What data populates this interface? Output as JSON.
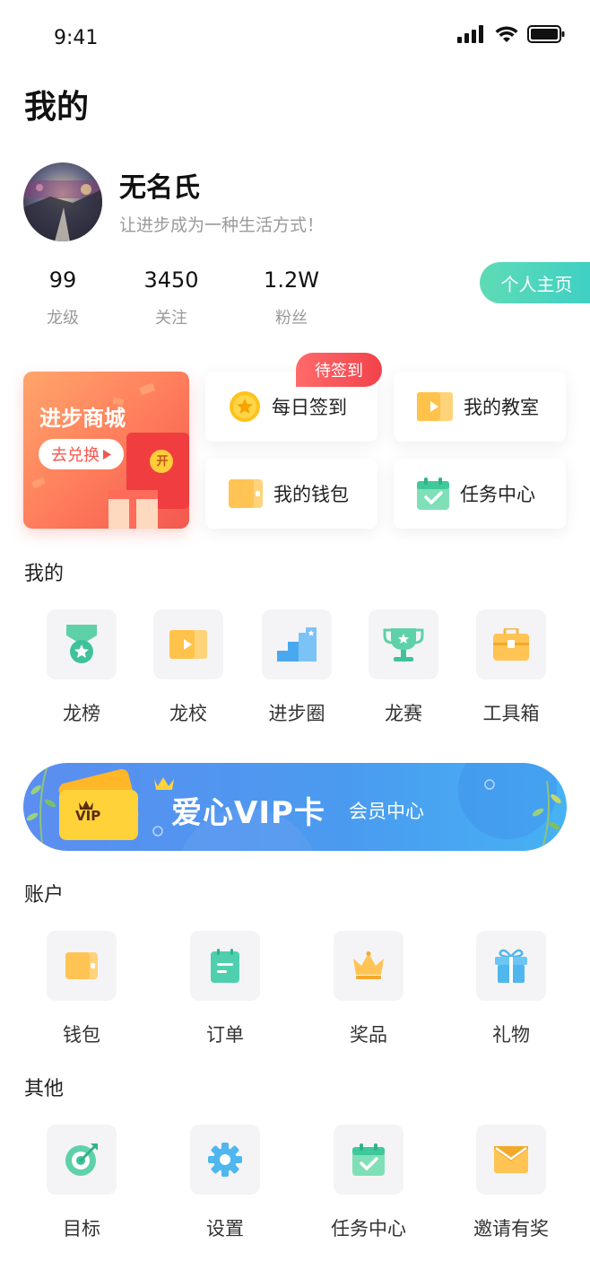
{
  "status_bar": {
    "time": "9:41"
  },
  "page": {
    "title": "我的"
  },
  "profile": {
    "name": "无名氏",
    "motto": "让进步成为一种生活方式！",
    "stats": [
      {
        "value": "99",
        "label": "龙级"
      },
      {
        "value": "3450",
        "label": "关注"
      },
      {
        "value": "1.2W",
        "label": "粉丝"
      }
    ],
    "homepage_button": "个人主页"
  },
  "promo": {
    "mall_title": "进步商城",
    "mall_button": "去兑换",
    "badge": "待签到",
    "open_label": "开",
    "quick": [
      {
        "label": "每日签到",
        "icon": "coin-star-icon"
      },
      {
        "label": "我的教室",
        "icon": "play-folder-icon"
      },
      {
        "label": "我的钱包",
        "icon": "wallet-icon"
      },
      {
        "label": "任务中心",
        "icon": "calendar-check-icon"
      }
    ]
  },
  "mine": {
    "title": "我的",
    "items": [
      {
        "label": "龙榜",
        "icon": "medal-icon"
      },
      {
        "label": "龙校",
        "icon": "video-icon"
      },
      {
        "label": "进步圈",
        "icon": "stairs-icon"
      },
      {
        "label": "龙赛",
        "icon": "trophy-icon"
      },
      {
        "label": "工具箱",
        "icon": "toolbox-icon"
      }
    ]
  },
  "vip": {
    "card_label": "VIP",
    "title": "爱心VIP卡",
    "subtitle": "会员中心"
  },
  "account": {
    "title": "账户",
    "items": [
      {
        "label": "钱包",
        "icon": "wallet-icon"
      },
      {
        "label": "订单",
        "icon": "order-icon"
      },
      {
        "label": "奖品",
        "icon": "crown-icon"
      },
      {
        "label": "礼物",
        "icon": "gift-icon"
      }
    ]
  },
  "other": {
    "title": "其他",
    "items": [
      {
        "label": "目标",
        "icon": "target-icon"
      },
      {
        "label": "设置",
        "icon": "gear-icon"
      },
      {
        "label": "任务中心",
        "icon": "calendar-check-icon"
      },
      {
        "label": "邀请有奖",
        "icon": "envelope-icon"
      }
    ]
  },
  "colors": {
    "accent_green": "#3fd0c4",
    "accent_orange": "#ff7e5c",
    "badge_red": "#f2424b",
    "vip_blue": "#4a9bf0"
  }
}
